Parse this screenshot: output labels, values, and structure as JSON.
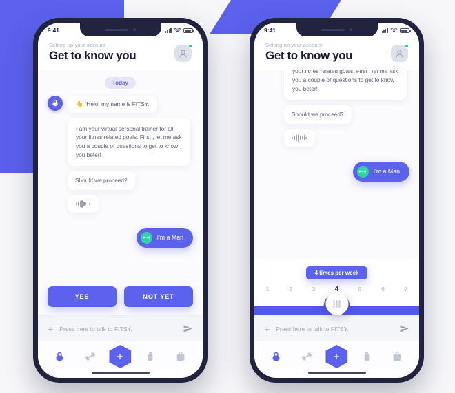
{
  "theme": {
    "accent": "#5c61ee",
    "accent_dark": "#5258ea",
    "bg_page": "#f7f7fa",
    "phone_frame": "#22243f",
    "green_dot": "#2ed47a",
    "green_icon": "#2ed4a0",
    "bubble_text": "#5a5f7a",
    "title_text": "#1b1d33",
    "muted": "#a9adc2"
  },
  "status_bar": {
    "time": "9:41",
    "signal_icon": "signal-bars-icon",
    "wifi_icon": "wifi-icon",
    "battery_icon": "battery-icon"
  },
  "header": {
    "subtitle": "Setting up your account",
    "title": "Get to know you",
    "profile_icon": "profile-avatar-icon",
    "online_status": "online"
  },
  "chat": {
    "day_label": "Today",
    "bot_avatar_icon": "kettlebell-bot-avatar-icon",
    "messages": [
      {
        "id": "greeting",
        "from": "bot",
        "emoji": "👋",
        "text": "Helo, my name is FITSY."
      },
      {
        "id": "intro",
        "from": "bot",
        "text": "I am your virtual personal trainer for all your fitnes related goals. First , let me ask you a couple of questions to get to know you beter!"
      },
      {
        "id": "proceed",
        "from": "bot",
        "text": "Should we proceed?"
      },
      {
        "id": "voice-note",
        "from": "bot",
        "type": "voice",
        "icon": "audio-waveform-icon"
      },
      {
        "id": "user-gender",
        "from": "user",
        "icon": "gender-male-icon",
        "text": "I'm a Man"
      }
    ]
  },
  "cta": {
    "yes_label": "YES",
    "not_yet_label": "NOT YET"
  },
  "slider": {
    "tooltip": "4 times per week",
    "ticks": [
      "1",
      "2",
      "3",
      "4",
      "5",
      "6",
      "7"
    ],
    "value": "4",
    "min": "1",
    "max": "7",
    "handle_icon": "slider-grip-icon"
  },
  "composer": {
    "add_icon": "plus-icon",
    "placeholder": "Press here to talk to FITSY.",
    "value": "",
    "send_icon": "send-icon"
  },
  "navbar": {
    "items": [
      {
        "id": "workouts",
        "icon": "kettlebell-icon",
        "active": true
      },
      {
        "id": "exercises",
        "icon": "dumbbell-icon",
        "active": false
      },
      {
        "id": "add",
        "icon": "plus-hex-icon",
        "active": true
      },
      {
        "id": "supplements",
        "icon": "supplement-bottle-icon",
        "active": false
      },
      {
        "id": "shop",
        "icon": "shopping-bag-icon",
        "active": false
      }
    ],
    "home_indicator": "home-indicator"
  },
  "phones": [
    {
      "id": "phone-left",
      "scrolled": false,
      "shows": "cta-buttons"
    },
    {
      "id": "phone-right",
      "scrolled": true,
      "shows": "frequency-slider"
    }
  ]
}
